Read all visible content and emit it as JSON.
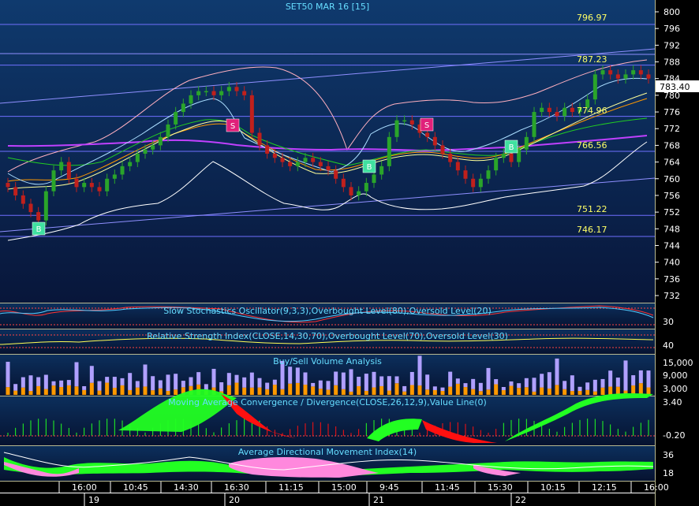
{
  "title": "SET50 MAR 16   [15]",
  "colors": {
    "panel_top": "#0f3a6e",
    "panel_bottom": "#08163a",
    "candle_up": "#2aa52a",
    "candle_down": "#c0201c",
    "hline": "#6f6fff",
    "label_yellow": "#ffff66",
    "macd_pos": "#22ff22",
    "macd_neg": "#ff1010",
    "adx_pos": "#22ff22",
    "adx_neg": "#ff88dd",
    "buy_vol": "#ff9900",
    "sell_vol": "#b0a0ff",
    "signal_buy": "#40e0a0",
    "signal_sell": "#e0207a"
  },
  "price_axis": {
    "ticks": [
      "800",
      "796",
      "792",
      "788",
      "784",
      "780",
      "776",
      "772",
      "768",
      "764",
      "760",
      "756",
      "752",
      "748",
      "744",
      "740",
      "736",
      "732"
    ],
    "last_price": "783.40"
  },
  "level_labels": [
    "796.97",
    "787.23",
    "774.96",
    "766.56",
    "751.22",
    "746.17"
  ],
  "signals": {
    "buy": "B",
    "sell": "S"
  },
  "indicators": {
    "stoch": {
      "title": "Slow Stochastics Oscillator(9,3,3),Overbought Level(80),Oversold Level(20)",
      "tick": "30"
    },
    "rsi": {
      "title": "Relative Strength Index(CLOSE,14,30,70),Overbought Level(70),Oversold Level(30)",
      "tick": "40"
    },
    "volume": {
      "title": "Buy/Sell Volume Analysis",
      "ticks": [
        "15,000",
        "9,000",
        "3,000"
      ]
    },
    "macd": {
      "title": "Moving Average Convergence / Divergence(CLOSE,26,12,9),Value Line(0)",
      "ticks": [
        "3.40",
        "-0.20"
      ]
    },
    "adx": {
      "title": "Average Directional Movement Index(14)",
      "ticks": [
        "36",
        "18"
      ]
    }
  },
  "time_axis": {
    "times": [
      "16:00",
      "10:45",
      "14:30",
      "16:30",
      "11:15",
      "15:00",
      "9:45",
      "11:45",
      "15:30",
      "10:15",
      "12:15",
      "16:00"
    ],
    "days": [
      "19",
      "20",
      "21",
      "22"
    ]
  },
  "chart_data": {
    "type": "candlestick",
    "title": "SET50 MAR 16   [15]",
    "interval_minutes": 15,
    "ylim": [
      730,
      802
    ],
    "horizontal_levels": [
      796.97,
      787.23,
      774.96,
      766.56,
      751.22,
      746.17
    ],
    "last_price": 783.4,
    "closes": [
      758,
      756,
      754,
      752,
      750,
      757,
      762,
      764,
      760,
      758,
      759,
      758,
      757,
      760,
      761,
      763,
      764,
      766,
      767,
      768,
      770,
      773,
      776,
      778,
      780,
      781,
      781,
      780,
      781,
      782,
      781,
      780,
      771,
      768,
      766,
      765,
      764,
      763,
      764,
      765,
      764,
      763,
      762,
      760,
      758,
      756,
      757,
      759,
      761,
      763,
      770,
      774,
      774,
      773,
      771,
      770,
      768,
      766,
      764,
      762,
      760,
      758,
      760,
      762,
      765,
      766,
      764,
      767,
      770,
      776,
      777,
      776,
      775,
      777,
      776,
      777,
      779,
      785,
      786,
      785,
      784,
      785,
      786,
      785,
      784
    ],
    "buy_signals": 3,
    "sell_signals": 2
  }
}
